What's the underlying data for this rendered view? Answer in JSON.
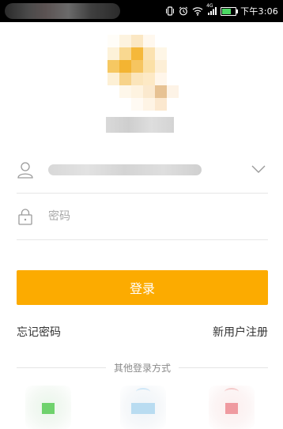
{
  "status_bar": {
    "time": "下午3:06",
    "network_label": "4G",
    "icons": [
      "vibrate-icon",
      "alarm-icon",
      "wifi-icon",
      "signal-icon",
      "battery-icon"
    ]
  },
  "login_form": {
    "password_placeholder": "密码",
    "login_label": "登录",
    "forgot_password_label": "忘记密码",
    "register_label": "新用户注册"
  },
  "other_login": {
    "title": "其他登录方式",
    "providers": [
      "wechat-login-icon",
      "qq-login-icon",
      "weibo-login-icon"
    ]
  },
  "colors": {
    "accent": "#fcab00",
    "status_bar": "#000000",
    "text": "#333333",
    "placeholder": "#a8a8a8",
    "divider": "#e6e6e6"
  }
}
